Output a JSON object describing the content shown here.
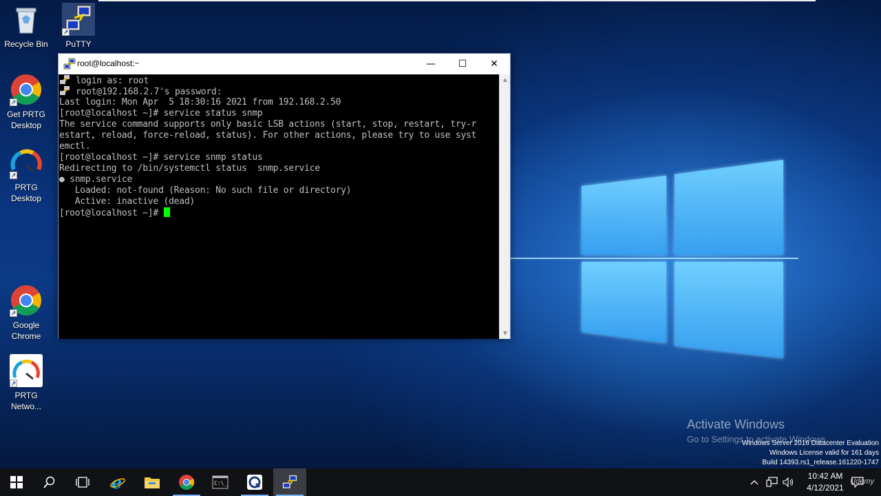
{
  "desktop": {
    "icons": [
      {
        "label": "Recycle Bin"
      },
      {
        "label": "PuTTY"
      },
      {
        "label": "Get PRTG Desktop"
      },
      {
        "label": "PRTG Desktop"
      },
      {
        "label": "Google Chrome"
      },
      {
        "label": "PRTG Netwo..."
      }
    ],
    "activate_title": "Activate Windows",
    "activate_sub": "Go to Settings to activate Windows.",
    "build_lines": [
      "Windows Server 2016 Datacenter Evaluation",
      "Windows License valid for 161 days",
      "Build 14393.rs1_release.161220-1747"
    ]
  },
  "putty": {
    "title": "root@localhost:~",
    "minimize_glyph": "—",
    "maximize_glyph": "☐",
    "close_glyph": "✕",
    "lines": [
      "login as: root",
      "root@192.168.2.7's password:",
      "Last login: Mon Apr  5 18:30:16 2021 from 192.168.2.50",
      "[root@localhost ~]# service status snmp",
      "The service command supports only basic LSB actions (start, stop, restart, try-r",
      "estart, reload, force-reload, status). For other actions, please try to use syst",
      "emctl.",
      "[root@localhost ~]# service snmp status",
      "Redirecting to /bin/systemctl status  snmp.service",
      "● snmp.service",
      "   Loaded: not-found (Reason: No such file or directory)",
      "   Active: inactive (dead)",
      "[root@localhost ~]# "
    ]
  },
  "taskbar": {
    "time": "10:42 AM",
    "date": "4/12/2021",
    "watermark": "Udemy"
  },
  "colors": {
    "terminal_bg": "#000000",
    "terminal_fg": "#c0c0c0",
    "cursor": "#00ff00",
    "taskbar": "#101216"
  }
}
